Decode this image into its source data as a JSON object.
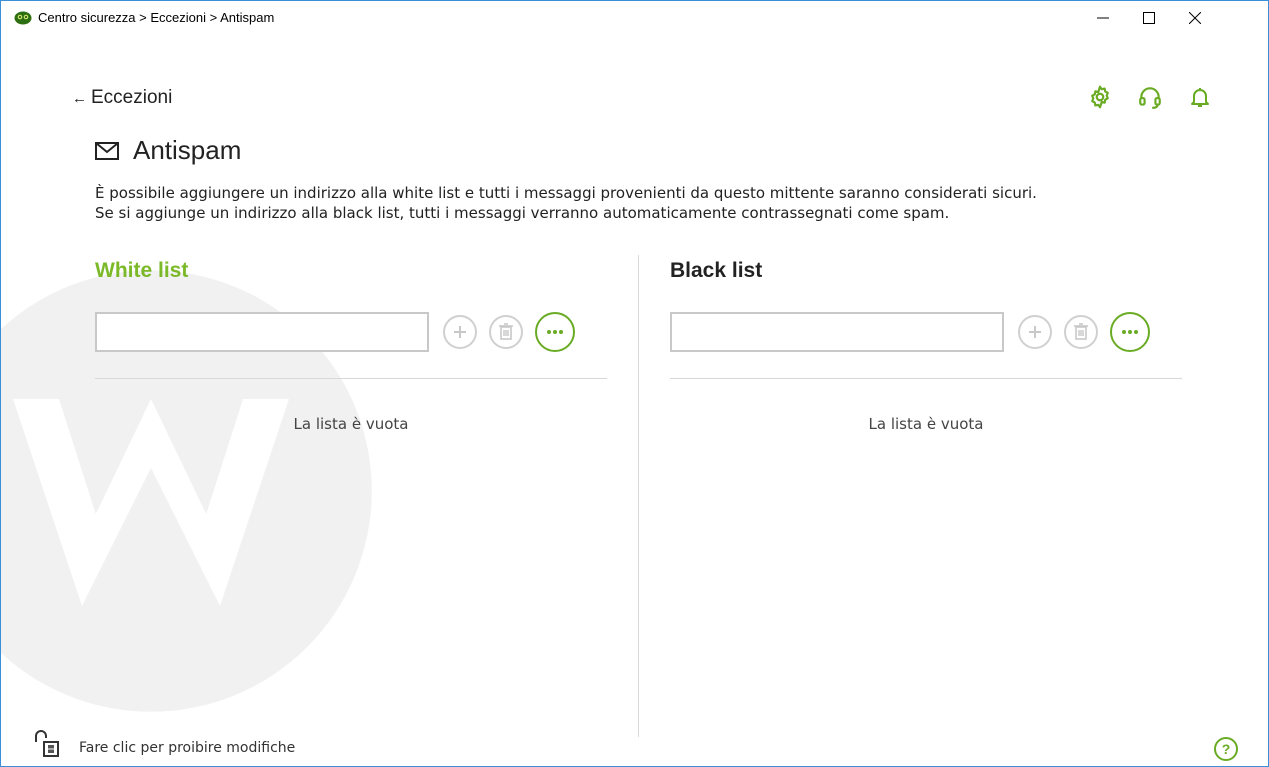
{
  "window": {
    "title": "Centro sicurezza > Eccezioni > Antispam",
    "accent_color": "#7bb928",
    "border_color": "#3a8fd8"
  },
  "nav": {
    "back_arrow": "←",
    "back_label": "Eccezioni"
  },
  "header_icons": [
    "gear-icon",
    "headset-icon",
    "bell-icon"
  ],
  "page": {
    "title": "Antispam",
    "description_line1": "È possibile aggiungere un indirizzo alla white list e tutti i messaggi provenienti da questo mittente saranno considerati sicuri.",
    "description_line2": "Se si aggiunge un indirizzo alla black list, tutti i messaggi verranno automaticamente contrassegnati come spam."
  },
  "white_list": {
    "title": "White list",
    "input_value": "",
    "empty_text": "La lista è vuota"
  },
  "black_list": {
    "title": "Black list",
    "input_value": "",
    "empty_text": "La lista è vuota"
  },
  "footer": {
    "lock_text": "Fare clic per proibire modifiche",
    "help_label": "?"
  }
}
